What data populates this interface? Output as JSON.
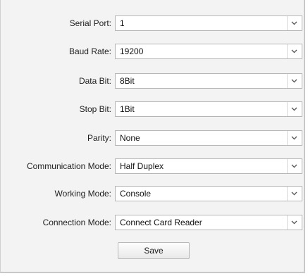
{
  "form": {
    "fields": [
      {
        "label": "Serial Port:",
        "value": "1"
      },
      {
        "label": "Baud Rate:",
        "value": "19200"
      },
      {
        "label": "Data Bit:",
        "value": "8Bit"
      },
      {
        "label": "Stop Bit:",
        "value": "1Bit"
      },
      {
        "label": "Parity:",
        "value": "None"
      },
      {
        "label": "Communication Mode:",
        "value": "Half Duplex"
      },
      {
        "label": "Working Mode:",
        "value": "Console"
      },
      {
        "label": "Connection Mode:",
        "value": "Connect Card Reader"
      }
    ],
    "save_label": "Save"
  },
  "icons": {
    "dropdown": "chevron-down-icon"
  },
  "colors": {
    "panel_background": "#f3f3f3",
    "field_background": "#ffffff",
    "field_border": "#b6b6b6"
  }
}
